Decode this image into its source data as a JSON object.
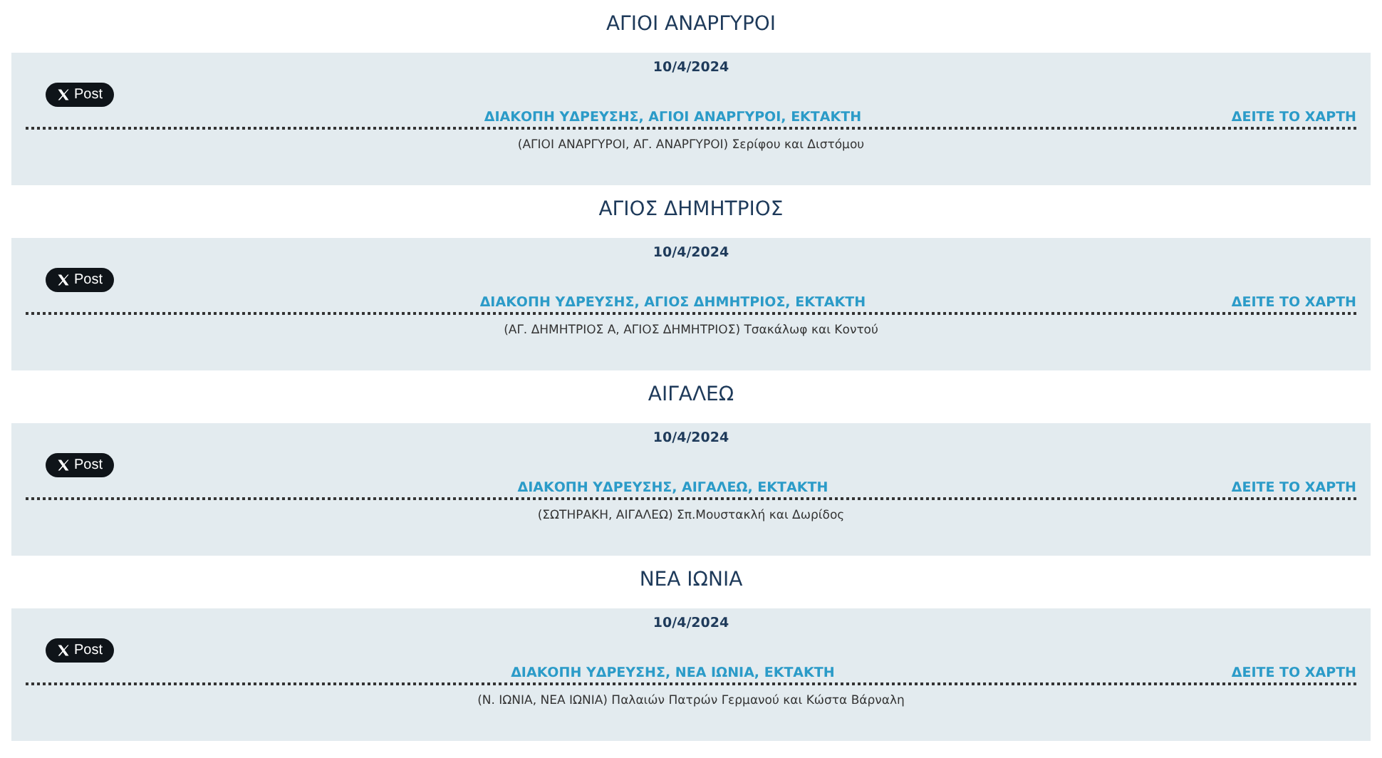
{
  "sections": [
    {
      "area": "ΑΓΙΟΙ ΑΝΑΡΓΥΡΟΙ",
      "date": "10/4/2024",
      "post_button": "Post",
      "title": "ΔΙΑΚΟΠΗ ΥΔΡΕΥΣΗΣ, ΑΓΙΟΙ ΑΝΑΡΓΥΡΟΙ, ΕΚΤΑΚΤΗ",
      "map_link": "ΔΕΙΤΕ ΤΟ ΧΑΡΤΗ",
      "address": "(ΑΓΙΟΙ ΑΝΑΡΓΥΡΟΙ, ΑΓ. ΑΝΑΡΓΥΡΟΙ) Σερίφου και Διστόμου"
    },
    {
      "area": "ΑΓΙΟΣ ΔΗΜΗΤΡΙΟΣ",
      "date": "10/4/2024",
      "post_button": "Post",
      "title": "ΔΙΑΚΟΠΗ ΥΔΡΕΥΣΗΣ, ΑΓΙΟΣ ΔΗΜΗΤΡΙΟΣ, ΕΚΤΑΚΤΗ",
      "map_link": "ΔΕΙΤΕ ΤΟ ΧΑΡΤΗ",
      "address": "(ΑΓ. ΔΗΜΗΤΡΙΟΣ Α, ΑΓΙΟΣ ΔΗΜΗΤΡΙΟΣ) Τσακάλωφ και Κοντού"
    },
    {
      "area": "ΑΙΓΑΛΕΩ",
      "date": "10/4/2024",
      "post_button": "Post",
      "title": "ΔΙΑΚΟΠΗ ΥΔΡΕΥΣΗΣ, ΑΙΓΑΛΕΩ, ΕΚΤΑΚΤΗ",
      "map_link": "ΔΕΙΤΕ ΤΟ ΧΑΡΤΗ",
      "address": "(ΣΩΤΗΡΑΚΗ, ΑΙΓΑΛΕΩ) Σπ.Μουστακλή και Δωρίδος"
    },
    {
      "area": "ΝΕΑ ΙΩΝΙΑ",
      "date": "10/4/2024",
      "post_button": "Post",
      "title": "ΔΙΑΚΟΠΗ ΥΔΡΕΥΣΗΣ, ΝΕΑ ΙΩΝΙΑ, ΕΚΤΑΚΤΗ",
      "map_link": "ΔΕΙΤΕ ΤΟ ΧΑΡΤΗ",
      "address": "(Ν. ΙΩΝΙΑ, ΝΕΑ ΙΩΝΙΑ) Παλαιών Πατρών Γερμανού και Κώστα Βάρναλη"
    }
  ]
}
